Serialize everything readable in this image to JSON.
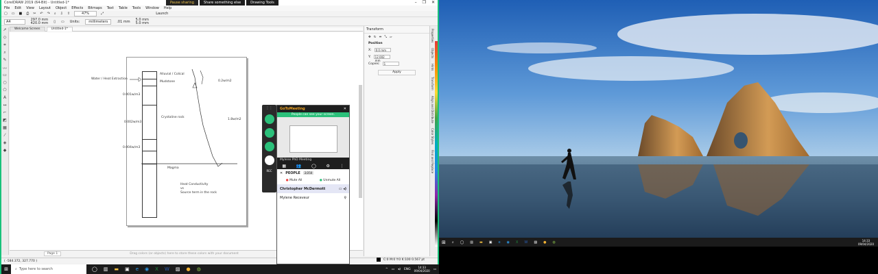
{
  "app": {
    "title": "CorelDRAW 2019 (64-Bit) - Untitled-1*",
    "window_controls": [
      "–",
      "❐",
      "✕"
    ]
  },
  "share_bar": {
    "pause": "Pause sharing",
    "share_else": "Share something else",
    "drawing_tools": "Drawing Tools"
  },
  "menus": [
    "File",
    "Edit",
    "View",
    "Layout",
    "Object",
    "Effects",
    "Bitmaps",
    "Text",
    "Table",
    "Tools",
    "Window",
    "Help"
  ],
  "toolbar": {
    "zoom": "47%",
    "launch": "Launch"
  },
  "property_bar": {
    "paper": "A4",
    "width": "297.0 mm",
    "height": "420.0 mm",
    "units_label": "Units:",
    "units_value": "millimeters",
    "nudge": ".01 mm",
    "dup_x": "5.0 mm",
    "dup_y": "5.0 mm"
  },
  "doc_tabs": [
    "Welcome Screen",
    "Untitled-1*"
  ],
  "drawing": {
    "labels": {
      "water": "Water / Heat Extraction",
      "alluvial": "Alluvial / Colical",
      "mudstone": "Mudstone",
      "flux1": "0.2w/m2",
      "d1": "0.001w/m3",
      "d2": "0.002w/m3",
      "d3": "0.004w/m3",
      "crystaline": "Crystaline rock",
      "flux2": "1.8w/m2",
      "magma": "Magma",
      "note1": "Heat Conductivity",
      "note2": "vs",
      "note3": "Source term in the rock"
    }
  },
  "canvas_status": {
    "page": "Page 1",
    "hint": "Drag colors (or objects) here to store these colors with your document"
  },
  "status_bar": {
    "coords": "( -584.372, 327.770 )",
    "color_info": "C:0 M:0 Y:0 K:100  0.567 pt"
  },
  "docker": {
    "title": "Transform",
    "position": "Position",
    "x_label": "X:",
    "x_value": "0.0 mm",
    "y_label": "Y:",
    "y_value": "12.002 mm",
    "copies_label": "Copies:",
    "copies_value": "1",
    "apply": "Apply",
    "side_tabs": [
      "Properties",
      "Objects",
      "Hints",
      "Transform",
      "Align and Distribute",
      "Color Styles",
      "Find and Replace"
    ]
  },
  "gotomeeting": {
    "brand": "GoToMeeting",
    "share_note": "People can see your screen.",
    "meeting_name": "Mylene PhD Meeting",
    "people_label": "PEOPLE",
    "people_count": "2/250",
    "mute_all": "Mute All",
    "unmute_all": "Unmute All",
    "attendees": [
      "Christopher McDermott",
      "Mylene Receveur"
    ],
    "rec_label": "REC"
  },
  "taskbar_left": {
    "search_placeholder": "Type here to search",
    "lang": "ENG",
    "time": "14:33",
    "date": "09/04/2020"
  },
  "taskbar_right": {
    "time": "14:33",
    "date": "09/04/2020"
  },
  "colors": {
    "share_border": "#18c27b",
    "gtm_green": "#2bc07a",
    "taskbar": "#1b1b1b"
  }
}
